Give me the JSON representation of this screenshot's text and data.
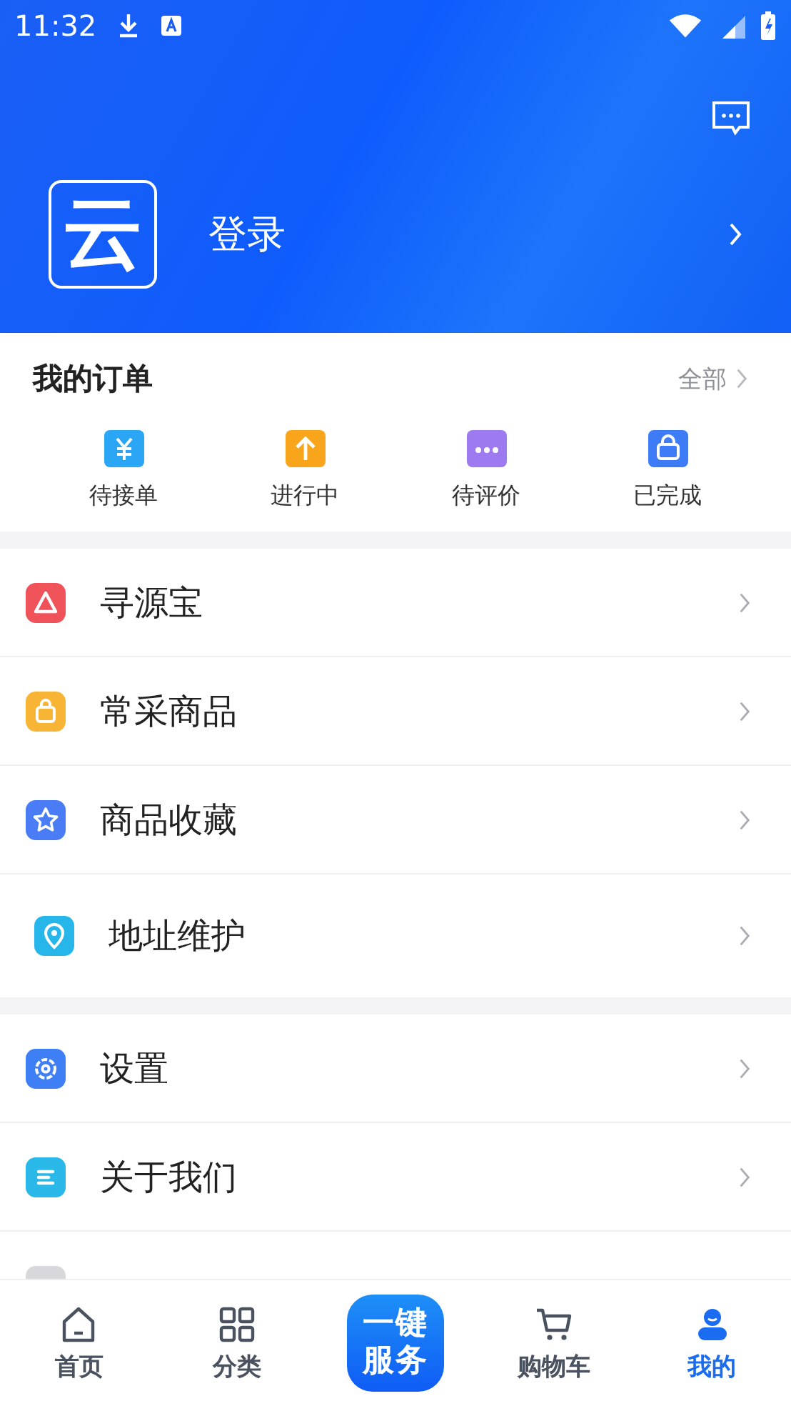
{
  "status_bar": {
    "time": "11:32"
  },
  "header": {
    "logo": "云",
    "login": "登录"
  },
  "orders": {
    "title": "我的订单",
    "all": "全部",
    "items": [
      {
        "label": "待接单",
        "color": "#2aa6f5"
      },
      {
        "label": "进行中",
        "color": "#f9a51c"
      },
      {
        "label": "待评价",
        "color": "#9d7af0"
      },
      {
        "label": "已完成",
        "color": "#3d7cf6"
      }
    ]
  },
  "menu_groups": [
    [
      {
        "label": "寻源宝",
        "color": "#f0525a"
      },
      {
        "label": "常采商品",
        "color": "#f8b535"
      },
      {
        "label": "商品收藏",
        "color": "#4a7cf5"
      },
      {
        "label": "地址维护",
        "color": "#27b6ea"
      }
    ],
    [
      {
        "label": "设置",
        "color": "#3f7ff5"
      },
      {
        "label": "关于我们",
        "color": "#2ab8e8"
      },
      {
        "color": "#d8d8dc"
      }
    ]
  ],
  "tab_bar": [
    {
      "kind": "tab",
      "label": "首页",
      "selected": false
    },
    {
      "kind": "tab",
      "label": "分类",
      "selected": false
    },
    {
      "kind": "action",
      "label": "一键服务",
      "selected": false
    },
    {
      "kind": "tab",
      "label": "购物车",
      "selected": false
    },
    {
      "kind": "tab",
      "label": "我的",
      "selected": true
    }
  ]
}
